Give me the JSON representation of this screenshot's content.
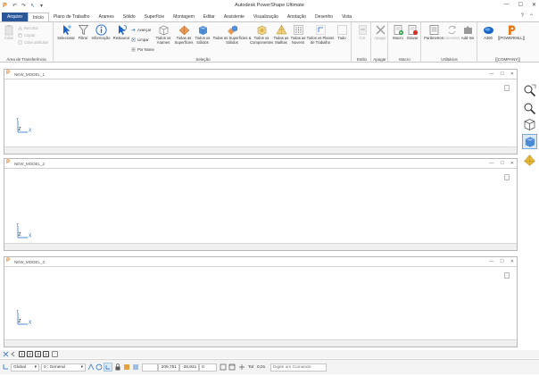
{
  "app": {
    "title": "Autodesk PowerShape Ultimate",
    "logo_letter": "P",
    "colors": {
      "accent": "#2b579a",
      "brand": "#e37b21",
      "axis": "#1a64c8"
    }
  },
  "window_controls": {
    "minimize": "—",
    "maximize": "☐",
    "close": "✕"
  },
  "quick_access": [
    {
      "icon": "app-logo-icon",
      "glyph": "P"
    },
    {
      "icon": "undo-icon",
      "glyph": "↶"
    },
    {
      "icon": "redo-icon",
      "glyph": "↷"
    },
    {
      "icon": "select-cursor-icon",
      "glyph": "↖"
    },
    {
      "icon": "dropdown-icon",
      "glyph": "▾"
    }
  ],
  "tabs": [
    "Arquivo",
    "Início",
    "Plano de Trabalho",
    "Arames",
    "Sólido",
    "Superfície",
    "Montagem",
    "Editar",
    "Assistente",
    "Visualização",
    "Anotação",
    "Desenho",
    "Vista"
  ],
  "tabs_right": {
    "help": "?",
    "collapse": "⌃"
  },
  "ribbon": {
    "groups": {
      "clipboard": "Área de Transferência",
      "selection": "Seleção",
      "style": "Estilo",
      "delete": "Apagar",
      "macro": "Macro",
      "utilities": "Utilitários",
      "company": "[[COMPANY]]"
    },
    "clipboard": {
      "paste": "Colar",
      "cut": "Recortar",
      "copy": "Copiar",
      "paste_attr": "Colar atributos"
    },
    "selection": {
      "select": "Selecionar",
      "filter": "Filtrar",
      "info": "Informação",
      "restore": "Restaurar",
      "advance": "Avançar",
      "clear": "Limpar",
      "by_name": "Por Nome",
      "all_wires": "Todos os Arames",
      "all_surfaces": "Todas as Superfícies",
      "all_solids": "Todos os Sólidos",
      "all_surf_solids": "Todas as Superfícies & Sólidos",
      "all_components": "Todos os Componentes",
      "all_meshes": "Todas as Malhas",
      "all_clouds": "Todas as Nuvens",
      "all_planes": "Todos os Planos de Trabalho",
      "all": "Tudo"
    },
    "style": {
      "color": "Cor"
    },
    "delete": {
      "delete": "Apagar"
    },
    "macro": {
      "macro": "Macro",
      "record": "Gravar"
    },
    "utilities": {
      "params": "Parâmetros",
      "convert": "Converter",
      "addins": "Add-Ins"
    },
    "company": {
      "a360": "A360",
      "powermill": "[[POWERMILL]]"
    }
  },
  "windows": [
    {
      "name": "NEW_MODEL_1"
    },
    {
      "name": "NEW_MODEL_2"
    },
    {
      "name": "NEW_MODEL_3"
    }
  ],
  "axes": {
    "x": "X",
    "y": "Y",
    "z": "Z"
  },
  "right_toolbar": [
    "zoom-fit-icon",
    "zoom-icon",
    "view-cube-icon",
    "shaded-view-icon",
    "material-icon"
  ],
  "status1": {
    "pages": [
      "1",
      "2",
      "3",
      "4"
    ]
  },
  "status2": {
    "workspace": "Global",
    "level": "0 : General",
    "coord_x": "209,751",
    "coord_y": "-28,931",
    "coord_z": "0",
    "tol_label": "Tol",
    "tol_value": "0,01",
    "command_placeholder": "Digite um Comando"
  }
}
